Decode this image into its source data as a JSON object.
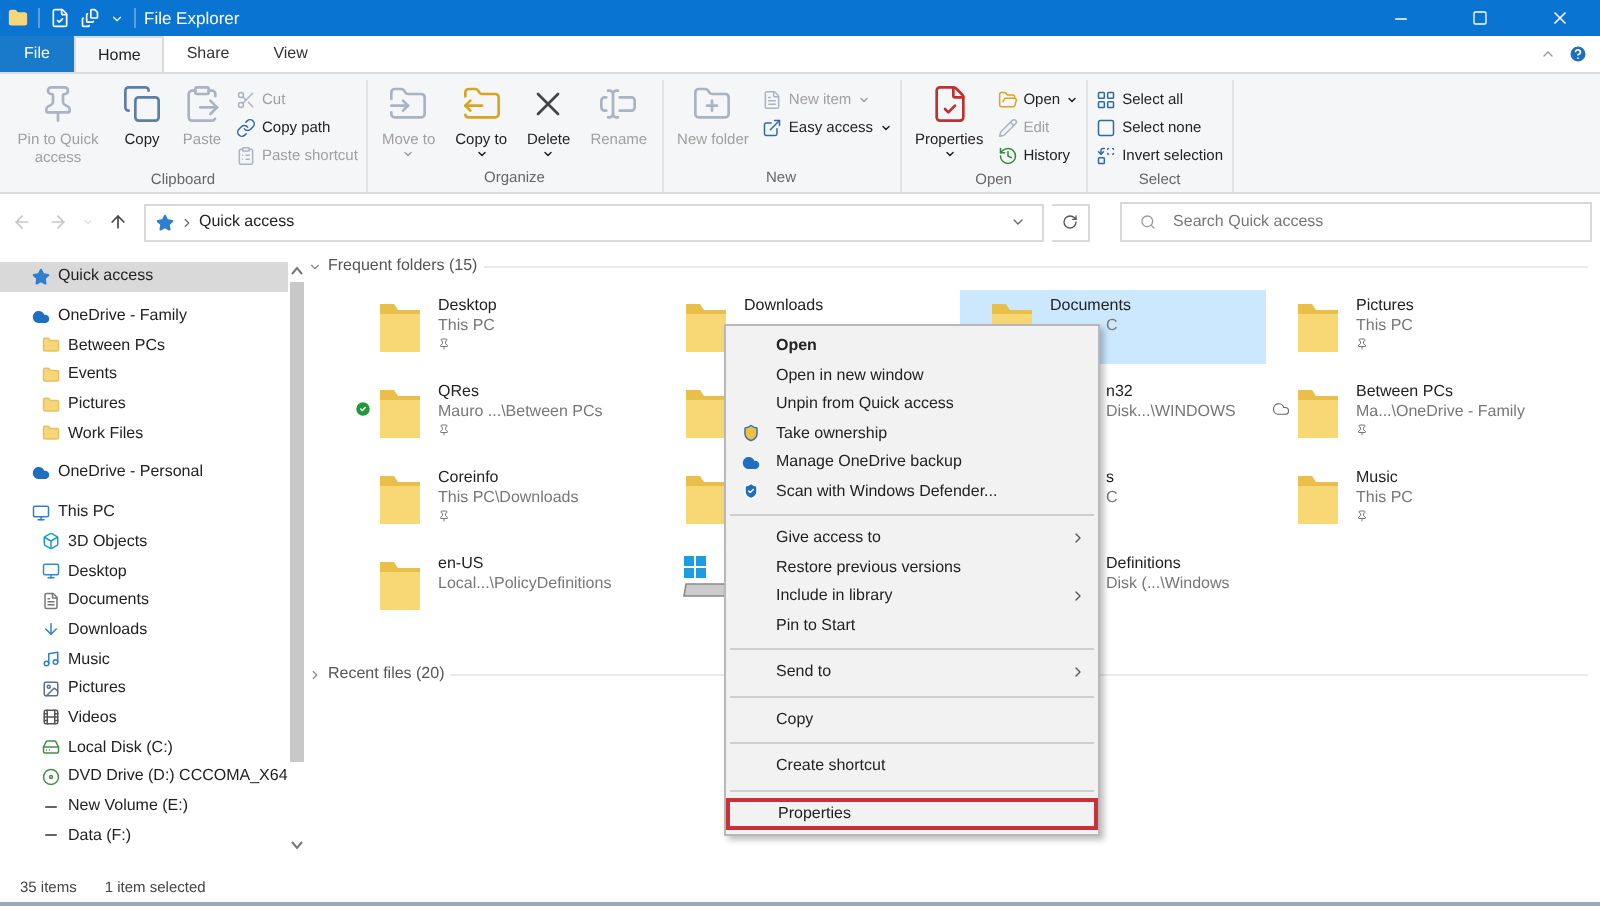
{
  "window": {
    "title": "File Explorer"
  },
  "ribbon_tabs": [
    {
      "label": "File",
      "kind": "file",
      "selected": false
    },
    {
      "label": "Home",
      "kind": "tab",
      "selected": true
    },
    {
      "label": "Share",
      "kind": "tab",
      "selected": false
    },
    {
      "label": "View",
      "kind": "tab",
      "selected": false
    }
  ],
  "ribbon_groups": [
    {
      "label": "Clipboard",
      "buttons": [
        {
          "label": "Pin to Quick access",
          "kind": "large",
          "disabled": true,
          "dropdown": false
        },
        {
          "label": "Copy",
          "kind": "large",
          "disabled": false,
          "dropdown": false
        },
        {
          "label": "Paste",
          "kind": "large",
          "disabled": true,
          "dropdown": false
        },
        {
          "label": "Cut",
          "kind": "small",
          "disabled": true,
          "dropdown": false
        },
        {
          "label": "Copy path",
          "kind": "small",
          "disabled": false,
          "dropdown": false
        },
        {
          "label": "Paste shortcut",
          "kind": "small",
          "disabled": true,
          "dropdown": false
        }
      ]
    },
    {
      "label": "Organize",
      "buttons": [
        {
          "label": "Move to",
          "kind": "large",
          "disabled": true,
          "dropdown": true
        },
        {
          "label": "Copy to",
          "kind": "large",
          "disabled": false,
          "dropdown": true
        },
        {
          "label": "Delete",
          "kind": "large",
          "disabled": false,
          "dropdown": true
        },
        {
          "label": "Rename",
          "kind": "large",
          "disabled": true,
          "dropdown": false
        }
      ]
    },
    {
      "label": "New",
      "buttons": [
        {
          "label": "New folder",
          "kind": "large",
          "disabled": true,
          "dropdown": false
        },
        {
          "label": "New item",
          "kind": "small",
          "disabled": true,
          "dropdown": true
        },
        {
          "label": "Easy access",
          "kind": "small",
          "disabled": false,
          "dropdown": true
        }
      ]
    },
    {
      "label": "Open",
      "buttons": [
        {
          "label": "Properties",
          "kind": "large",
          "disabled": false,
          "dropdown": true
        },
        {
          "label": "Open",
          "kind": "small",
          "disabled": false,
          "dropdown": true
        },
        {
          "label": "Edit",
          "kind": "small",
          "disabled": true,
          "dropdown": false
        },
        {
          "label": "History",
          "kind": "small",
          "disabled": false,
          "dropdown": false
        }
      ]
    },
    {
      "label": "Select",
      "buttons": [
        {
          "label": "Select all",
          "kind": "small",
          "disabled": false,
          "dropdown": false
        },
        {
          "label": "Select none",
          "kind": "small",
          "disabled": false,
          "dropdown": false
        },
        {
          "label": "Invert selection",
          "kind": "small",
          "disabled": false,
          "dropdown": false
        }
      ]
    }
  ],
  "nav_buttons": [
    {
      "kind": "back",
      "disabled": true
    },
    {
      "kind": "forward",
      "disabled": true
    },
    {
      "kind": "recent",
      "disabled": true
    },
    {
      "kind": "up",
      "disabled": false
    }
  ],
  "address": {
    "path": "Quick access"
  },
  "search": {
    "placeholder": "Search Quick access"
  },
  "sidebar": {
    "items": [
      {
        "label": "Quick access",
        "kind": "star",
        "selected": true
      },
      {
        "label": "OneDrive - Family",
        "kind": "cloud",
        "selected": false,
        "children": [
          {
            "label": "Between PCs",
            "kind": "folder",
            "selected": false
          },
          {
            "label": "Events",
            "kind": "folder",
            "selected": false
          },
          {
            "label": "Pictures",
            "kind": "folder",
            "selected": false
          },
          {
            "label": "Work Files",
            "kind": "folder",
            "selected": false
          }
        ]
      },
      {
        "label": "OneDrive - Personal",
        "kind": "cloud",
        "selected": false
      },
      {
        "label": "This PC",
        "kind": "pc",
        "selected": false,
        "children": [
          {
            "label": "3D Objects",
            "kind": "cube",
            "selected": false
          },
          {
            "label": "Desktop",
            "kind": "desktop",
            "selected": false
          },
          {
            "label": "Documents",
            "kind": "document",
            "selected": false
          },
          {
            "label": "Downloads",
            "kind": "download",
            "selected": false
          },
          {
            "label": "Music",
            "kind": "music",
            "selected": false
          },
          {
            "label": "Pictures",
            "kind": "pictures",
            "selected": false
          },
          {
            "label": "Videos",
            "kind": "video",
            "selected": false
          },
          {
            "label": "Local Disk (C:)",
            "kind": "disk",
            "selected": false
          },
          {
            "label": "DVD Drive (D:) CCCOMA_X64",
            "kind": "dvd",
            "selected": false
          },
          {
            "label": "New Volume (E:)",
            "kind": "drive",
            "selected": false
          },
          {
            "label": "Data (F:)",
            "kind": "drive",
            "selected": false
          }
        ]
      }
    ]
  },
  "sections": [
    {
      "title": "Frequent folders (15)",
      "expanded": true,
      "tiles": [
        {
          "name": "Desktop",
          "location": "This PC",
          "kind": "folder",
          "pinned": true,
          "synced": false,
          "cloud_only": false,
          "selected": false
        },
        {
          "name": "Downloads",
          "kind": "folder",
          "selected": false
        },
        {
          "name": "Documents",
          "location": "C",
          "kind": "folder",
          "selected": true
        },
        {
          "name": "Pictures",
          "location": "This PC",
          "kind": "folder",
          "pinned": true,
          "synced": false,
          "cloud_only": false,
          "selected": false
        },
        {
          "name": "QRes",
          "location": "Mauro ...\\Between PCs",
          "kind": "folder",
          "pinned": true,
          "synced": true,
          "cloud_only": false,
          "selected": false
        },
        {
          "kind": "folder",
          "selected": false
        },
        {
          "name": "n32",
          "location": "Disk...\\WINDOWS",
          "kind": "folder",
          "selected": false
        },
        {
          "name": "Between PCs",
          "location": "Ma...\\OneDrive - Family",
          "kind": "folder",
          "pinned": true,
          "synced": false,
          "cloud_only": true,
          "selected": false
        },
        {
          "name": "Coreinfo",
          "location": "This PC\\Downloads",
          "kind": "folder",
          "pinned": true,
          "synced": false,
          "cloud_only": false,
          "selected": false
        },
        {
          "kind": "folder",
          "selected": false
        },
        {
          "name": "s",
          "location": "C",
          "kind": "folder",
          "selected": false
        },
        {
          "name": "Music",
          "location": "This PC",
          "kind": "folder",
          "pinned": true,
          "synced": false,
          "cloud_only": false,
          "selected": false
        },
        {
          "name": "en-US",
          "location": "Local...\\PolicyDefinitions",
          "kind": "folder",
          "pinned": false,
          "synced": false,
          "cloud_only": false,
          "selected": false
        },
        {
          "kind": "drive",
          "selected": false
        },
        {
          "name": "Definitions",
          "location": "Disk (...\\Windows",
          "kind": "folder",
          "selected": false
        }
      ]
    },
    {
      "title": "Recent files (20)",
      "expanded": false
    }
  ],
  "context_menu": {
    "items": [
      {
        "kind": "item",
        "label": "Open",
        "default": true,
        "submenu": false,
        "highlighted": false
      },
      {
        "kind": "item",
        "label": "Open in new window",
        "default": false,
        "submenu": false,
        "highlighted": false
      },
      {
        "kind": "item",
        "label": "Unpin from Quick access",
        "default": false,
        "submenu": false,
        "highlighted": false
      },
      {
        "kind": "item",
        "label": "Take ownership",
        "default": false,
        "submenu": false,
        "highlighted": false
      },
      {
        "kind": "item",
        "label": "Manage OneDrive backup",
        "default": false,
        "submenu": false,
        "highlighted": false
      },
      {
        "kind": "item",
        "label": "Scan with Windows Defender...",
        "default": false,
        "submenu": false,
        "highlighted": false
      },
      {
        "kind": "separator"
      },
      {
        "kind": "item",
        "label": "Give access to",
        "default": false,
        "submenu": true,
        "highlighted": false
      },
      {
        "kind": "item",
        "label": "Restore previous versions",
        "default": false,
        "submenu": false,
        "highlighted": false
      },
      {
        "kind": "item",
        "label": "Include in library",
        "default": false,
        "submenu": true,
        "highlighted": false
      },
      {
        "kind": "item",
        "label": "Pin to Start",
        "default": false,
        "submenu": false,
        "highlighted": false
      },
      {
        "kind": "separator"
      },
      {
        "kind": "item",
        "label": "Send to",
        "default": false,
        "submenu": true,
        "highlighted": false
      },
      {
        "kind": "separator"
      },
      {
        "kind": "item",
        "label": "Copy",
        "default": false,
        "submenu": false,
        "highlighted": false
      },
      {
        "kind": "separator"
      },
      {
        "kind": "item",
        "label": "Create shortcut",
        "default": false,
        "submenu": false,
        "highlighted": false
      },
      {
        "kind": "separator"
      },
      {
        "kind": "item",
        "label": "Properties",
        "default": false,
        "submenu": false,
        "highlighted": true
      }
    ]
  },
  "status_bar": {
    "item_count": "35 items",
    "selection": "1 item selected"
  }
}
